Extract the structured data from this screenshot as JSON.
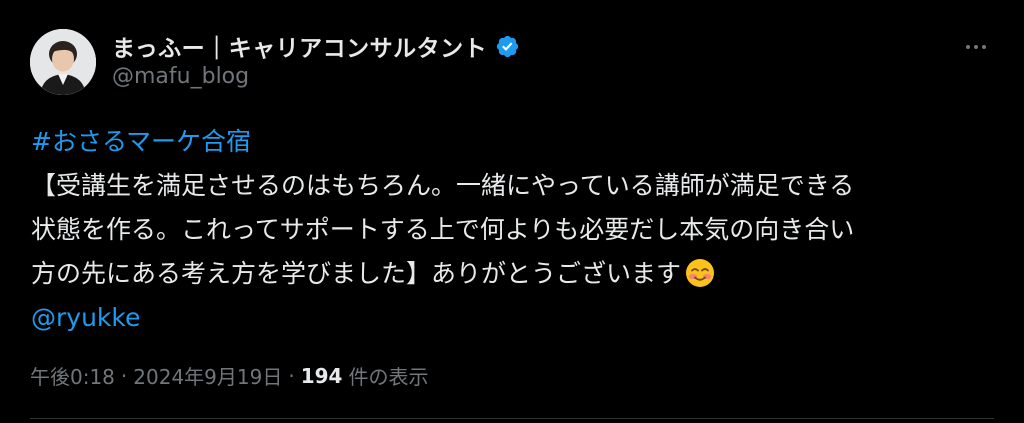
{
  "author": {
    "display_name": "まっふー｜キャリアコンサルタント",
    "handle": "@mafu_blog",
    "verified": true,
    "avatar": "person-portrait"
  },
  "tweet": {
    "hashtag": "#おさるマーケ合宿",
    "lines": [
      "【受講生を満足させるのはもちろん。一緒にやっている講師が満足できる",
      "状態を作る。これってサポートする上で何よりも必要だし本気の向き合い",
      "方の先にある考え方を学びました】ありがとうございます"
    ],
    "emoji": "smiling-face-with-blush",
    "mention": "@ryukke"
  },
  "meta": {
    "time": "午後0:18",
    "separator": "·",
    "date": "2024年9月19日",
    "views_count": "194",
    "views_label": "件の表示"
  },
  "colors": {
    "background": "#000000",
    "text": "#e7e9ea",
    "muted": "#71767b",
    "link": "#1d9bf0",
    "verified": "#1d9bf0"
  },
  "icons": {
    "more": "more-horizontal-icon",
    "verified": "verified-badge-icon"
  }
}
